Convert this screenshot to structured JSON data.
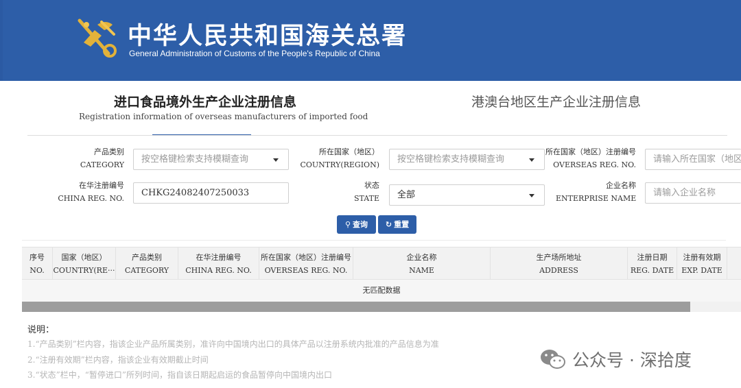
{
  "header": {
    "title_cn": "中华人民共和国海关总署",
    "title_en": "General Administration of Customs of the People's Republic of China"
  },
  "tabs": {
    "active_cn": "进口食品境外生产企业注册信息",
    "active_en": "Registration information of overseas manufacturers of imported food",
    "inactive_cn": "港澳台地区生产企业注册信息"
  },
  "form": {
    "category": {
      "label_cn": "产品类别",
      "label_en": "CATEGORY",
      "placeholder": "按空格键检索支持模糊查询"
    },
    "country": {
      "label_cn": "所在国家（地区）",
      "label_en": "COUNTRY(REGION)",
      "placeholder": "按空格键检索支持模糊查询"
    },
    "overseas_reg": {
      "label_cn": "所在国家（地区）注册编号",
      "label_en": "OVERSEAS REG. NO.",
      "placeholder": "请输入所在国家（地区）注册编号"
    },
    "china_reg": {
      "label_cn": "在华注册编号",
      "label_en": "CHINA REG. NO.",
      "value": "CHKG24082407250033"
    },
    "state": {
      "label_cn": "状态",
      "label_en": "STATE",
      "value": "全部"
    },
    "enterprise": {
      "label_cn": "企业名称",
      "label_en": "ENTERPRISE NAME",
      "placeholder": "请输入企业名称"
    }
  },
  "buttons": {
    "search_icon": "search-icon",
    "search_label": "查询",
    "reset_icon": "refresh-icon",
    "reset_label": "重置"
  },
  "table": {
    "columns": [
      {
        "cn": "序号",
        "en": "NO."
      },
      {
        "cn": "国家（地区）",
        "en": "COUNTRY(RE···"
      },
      {
        "cn": "产品类别",
        "en": "CATEGORY"
      },
      {
        "cn": "在华注册编号",
        "en": "CHINA REG. NO."
      },
      {
        "cn": "所在国家（地区）注册编号",
        "en": "OVERSEAS REG. NO."
      },
      {
        "cn": "企业名称",
        "en": "NAME"
      },
      {
        "cn": "生产场所地址",
        "en": "ADDRESS"
      },
      {
        "cn": "注册日期",
        "en": "REG. DATE"
      },
      {
        "cn": "注册有效期",
        "en": "EXP. DATE"
      }
    ],
    "empty_text": "无匹配数据"
  },
  "notes": {
    "title": "说明：",
    "items": [
      "1.“产品类别”栏内容，指该企业产品所属类别，准许向中国境内出口的具体产品以注册系统内批准的产品信息为准",
      "2.“注册有效期”栏内容，指该企业有效期截止时间",
      "3.“状态”栏中，“暂停进口”所列时间，指自该日期起启运的食品暂停向中国境内出口"
    ]
  },
  "watermark": {
    "text": "公众号 · 深拾度",
    "icon": "wechat-icon"
  },
  "colors": {
    "brand_blue": "#2d5ea8",
    "header_bg": "#f2f2f2",
    "scroll_thumb": "#9d9d9d"
  }
}
